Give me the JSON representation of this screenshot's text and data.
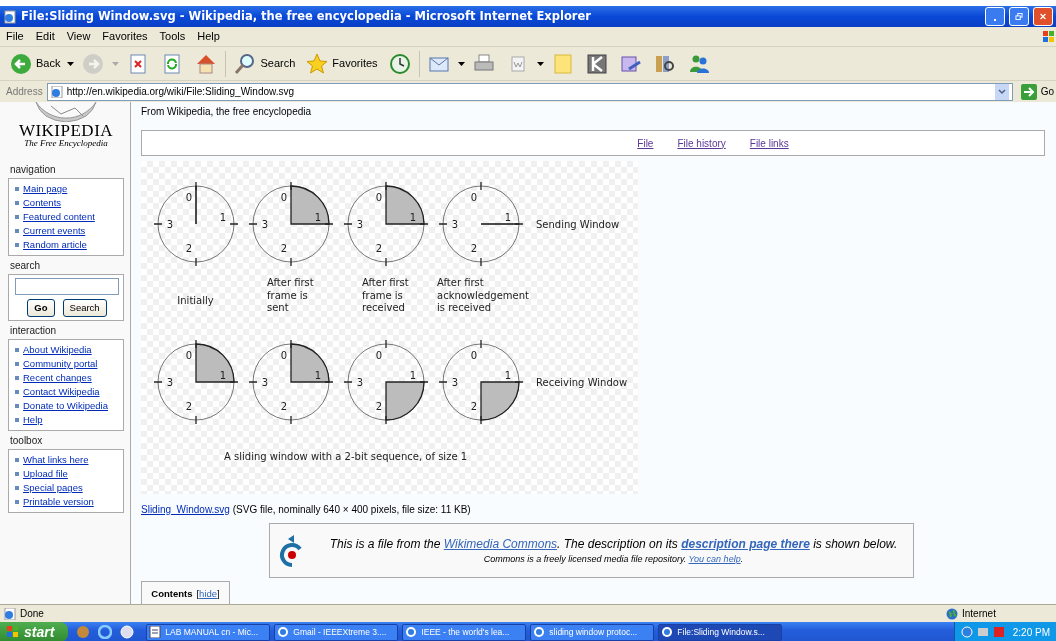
{
  "window": {
    "title": "File:Sliding Window.svg - Wikipedia, the free encyclopedia - Microsoft Internet Explorer"
  },
  "menu": [
    "File",
    "Edit",
    "View",
    "Favorites",
    "Tools",
    "Help"
  ],
  "toolbar": [
    {
      "kind": "back",
      "label": "Back",
      "dropdown": true,
      "disabled": false
    },
    {
      "kind": "forward",
      "dropdown": true,
      "disabled": true
    },
    {
      "kind": "stop",
      "dropdown": false,
      "disabled": false
    },
    {
      "kind": "refresh",
      "dropdown": false,
      "disabled": false
    },
    {
      "kind": "home",
      "dropdown": false,
      "disabled": false
    },
    {
      "kind": "search",
      "label": "Search",
      "dropdown": false,
      "disabled": false
    },
    {
      "kind": "favorites",
      "label": "Favorites",
      "dropdown": false,
      "disabled": false
    },
    {
      "kind": "history",
      "dropdown": false,
      "disabled": false
    },
    {
      "kind": "mail",
      "dropdown": true,
      "disabled": false
    },
    {
      "kind": "print",
      "dropdown": false,
      "disabled": false
    },
    {
      "kind": "edit",
      "dropdown": true,
      "disabled": false
    },
    {
      "kind": "note",
      "dropdown": false,
      "disabled": false
    },
    {
      "kind": "app",
      "dropdown": false,
      "disabled": false
    },
    {
      "kind": "chat",
      "dropdown": false,
      "disabled": false
    },
    {
      "kind": "research",
      "dropdown": false,
      "disabled": false
    },
    {
      "kind": "messenger",
      "dropdown": false,
      "disabled": false
    }
  ],
  "address": {
    "label": "Address",
    "value": "http://en.wikipedia.org/wiki/File:Sliding_Window.svg",
    "go": "Go"
  },
  "sidebar": {
    "logo": {
      "title": "WIKIPEDIA",
      "tagline": "The Free Encyclopedia"
    },
    "portlets": [
      {
        "heading": "navigation",
        "kind": "links",
        "items": [
          "Main page",
          "Contents",
          "Featured content",
          "Current events",
          "Random article"
        ]
      },
      {
        "heading": "search",
        "kind": "search",
        "buttons": [
          "Go",
          "Search"
        ]
      },
      {
        "heading": "interaction",
        "kind": "links",
        "items": [
          "About Wikipedia",
          "Community portal",
          "Recent changes",
          "Contact Wikipedia",
          "Donate to Wikipedia",
          "Help"
        ]
      },
      {
        "heading": "toolbox",
        "kind": "links",
        "items": [
          "What links here",
          "Upload file",
          "Special pages",
          "Printable version"
        ]
      }
    ]
  },
  "page": {
    "tagline": "From Wikipedia, the free encyclopedia",
    "file_tabs": [
      "File",
      "File history",
      "File links"
    ],
    "figure": {
      "rows": [
        {
          "label": "Sending Window",
          "clocks": [
            {
              "kind": "hand_up",
              "numbers": [
                "0",
                "1",
                "2",
                "3"
              ]
            },
            {
              "kind": "shade_ne",
              "numbers": [
                "0",
                "1",
                "2",
                "3"
              ]
            },
            {
              "kind": "shade_ne",
              "numbers": [
                "0",
                "1",
                "2",
                "3"
              ]
            },
            {
              "kind": "hand_right",
              "numbers": [
                "0",
                "1",
                "2",
                "3"
              ]
            }
          ]
        },
        {
          "label": "Receiving Window",
          "clocks": [
            {
              "kind": "shade_ne",
              "numbers": [
                "0",
                "1",
                "2",
                "3"
              ]
            },
            {
              "kind": "shade_ne",
              "numbers": [
                "0",
                "1",
                "2",
                "3"
              ]
            },
            {
              "kind": "shade_se",
              "numbers": [
                "0",
                "1",
                "2",
                "3"
              ]
            },
            {
              "kind": "shade_se",
              "numbers": [
                "0",
                "1",
                "2",
                "3"
              ]
            }
          ]
        }
      ],
      "captions": [
        "Initially",
        "After first frame is sent",
        "After first frame is received",
        "After first acknowledgement is received"
      ],
      "title": "A sliding window with a 2-bit sequence, of size 1"
    },
    "file_info": {
      "link": "Sliding_Window.svg",
      "text": "(SVG file, nominally 640 × 400 pixels, file size: 11 KB)"
    },
    "commons": {
      "line1": [
        {
          "kind": "text",
          "text": "This is a file from the "
        },
        {
          "kind": "link",
          "text": "Wikimedia Commons"
        },
        {
          "kind": "text",
          "text": ". The description on its "
        },
        {
          "kind": "boldlink",
          "text": "description page there"
        },
        {
          "kind": "text",
          "text": " is shown below."
        }
      ],
      "line2": [
        {
          "kind": "text",
          "text": "Commons is a freely licensed media file repository. "
        },
        {
          "kind": "link",
          "text": "You can help"
        },
        {
          "kind": "text",
          "text": "."
        }
      ]
    },
    "toc": [
      {
        "kind": "title",
        "text": "Contents"
      },
      {
        "kind": "text",
        "text": "["
      },
      {
        "kind": "link",
        "text": "hide"
      },
      {
        "kind": "text",
        "text": "]"
      }
    ]
  },
  "status_bar": {
    "text": "Done",
    "zone": "Internet"
  },
  "taskbar": {
    "start": "start",
    "tasks": [
      {
        "label": "LAB MANUAL cn - Mic...",
        "kind": "doc",
        "selected": false
      },
      {
        "label": "Gmail - IEEEXtreme 3....",
        "kind": "browser",
        "selected": false
      },
      {
        "label": "IEEE - the world's lea...",
        "kind": "browser",
        "selected": false
      },
      {
        "label": "sliding window protoc...",
        "kind": "browser",
        "selected": false
      },
      {
        "label": "File:Sliding Window.s...",
        "kind": "browser",
        "selected": true
      }
    ],
    "time": "2:20 PM"
  }
}
